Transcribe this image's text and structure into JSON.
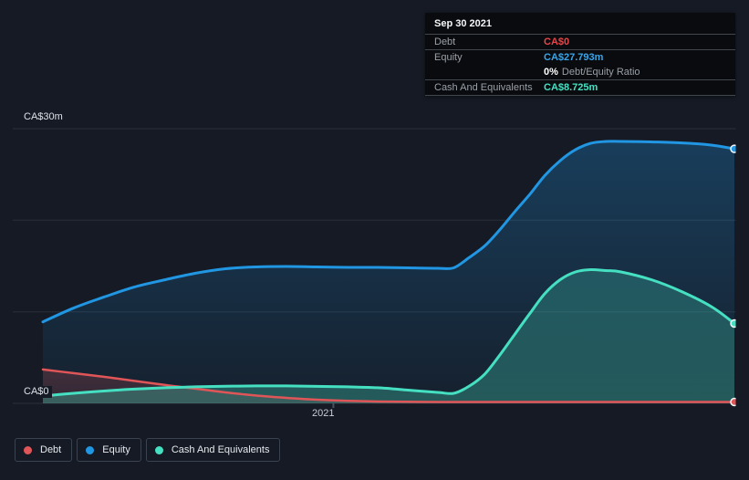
{
  "tooltip": {
    "date": "Sep 30 2021",
    "rows": [
      {
        "label": "Debt",
        "value": "CA$0",
        "color": "#e8464a"
      },
      {
        "label": "Equity",
        "value": "CA$27.793m",
        "color": "#38a6ea"
      },
      {
        "label": "",
        "ratio_value": "0%",
        "ratio_text": "Debt/Equity Ratio"
      },
      {
        "label": "Cash And Equivalents",
        "value": "CA$8.725m",
        "color": "#42e3c5"
      }
    ]
  },
  "chart_data": {
    "type": "area",
    "unit": "CA$ millions",
    "ylim": [
      0,
      30
    ],
    "grid": true,
    "legend_position": "bottom-left",
    "y_ticks": [
      {
        "label": "CA$30m",
        "value": 30
      },
      {
        "label": "CA$0",
        "value": 0
      }
    ],
    "gridline_values": [
      30,
      20,
      10,
      0
    ],
    "x_ticks": [
      {
        "label": "2021",
        "t": 0.42
      }
    ],
    "highlighted_point": {
      "date": "Sep 30 2021",
      "debt": 0,
      "equity": 27.793,
      "cash_and_equivalents": 8.725,
      "debt_equity_ratio_pct": 0
    },
    "x": [
      0,
      0.044,
      0.088,
      0.132,
      0.177,
      0.22,
      0.264,
      0.309,
      0.352,
      0.396,
      0.441,
      0.484,
      0.528,
      0.571,
      0.594,
      0.616,
      0.639,
      0.66,
      0.682,
      0.705,
      0.726,
      0.748,
      0.77,
      0.792,
      0.814,
      0.836,
      0.88,
      0.924,
      0.968,
      1.0
    ],
    "series": [
      {
        "key": "debt",
        "name": "Debt",
        "color": "#e05558",
        "values": [
          3.7,
          3.3,
          2.9,
          2.45,
          2.0,
          1.6,
          1.2,
          0.85,
          0.6,
          0.4,
          0.28,
          0.2,
          0.17,
          0.15,
          0.15,
          0.15,
          0.15,
          0.15,
          0.15,
          0.15,
          0.15,
          0.15,
          0.15,
          0.15,
          0.15,
          0.15,
          0.15,
          0.15,
          0.15,
          0.15
        ]
      },
      {
        "key": "equity",
        "name": "Equity",
        "color": "#2196e3",
        "values": [
          8.9,
          10.4,
          11.6,
          12.7,
          13.5,
          14.2,
          14.7,
          14.9,
          14.95,
          14.9,
          14.85,
          14.85,
          14.8,
          14.75,
          14.8,
          15.9,
          17.2,
          18.9,
          20.9,
          22.9,
          24.9,
          26.5,
          27.7,
          28.4,
          28.6,
          28.6,
          28.55,
          28.45,
          28.2,
          27.793
        ]
      },
      {
        "key": "cash",
        "name": "Cash And Equivalents",
        "color": "#45e0c2",
        "values": [
          0.8,
          1.1,
          1.35,
          1.55,
          1.7,
          1.8,
          1.87,
          1.9,
          1.9,
          1.85,
          1.8,
          1.7,
          1.45,
          1.2,
          1.1,
          1.85,
          3.2,
          5.2,
          7.5,
          9.9,
          12.0,
          13.5,
          14.35,
          14.6,
          14.5,
          14.35,
          13.5,
          12.2,
          10.5,
          8.725
        ]
      }
    ]
  }
}
